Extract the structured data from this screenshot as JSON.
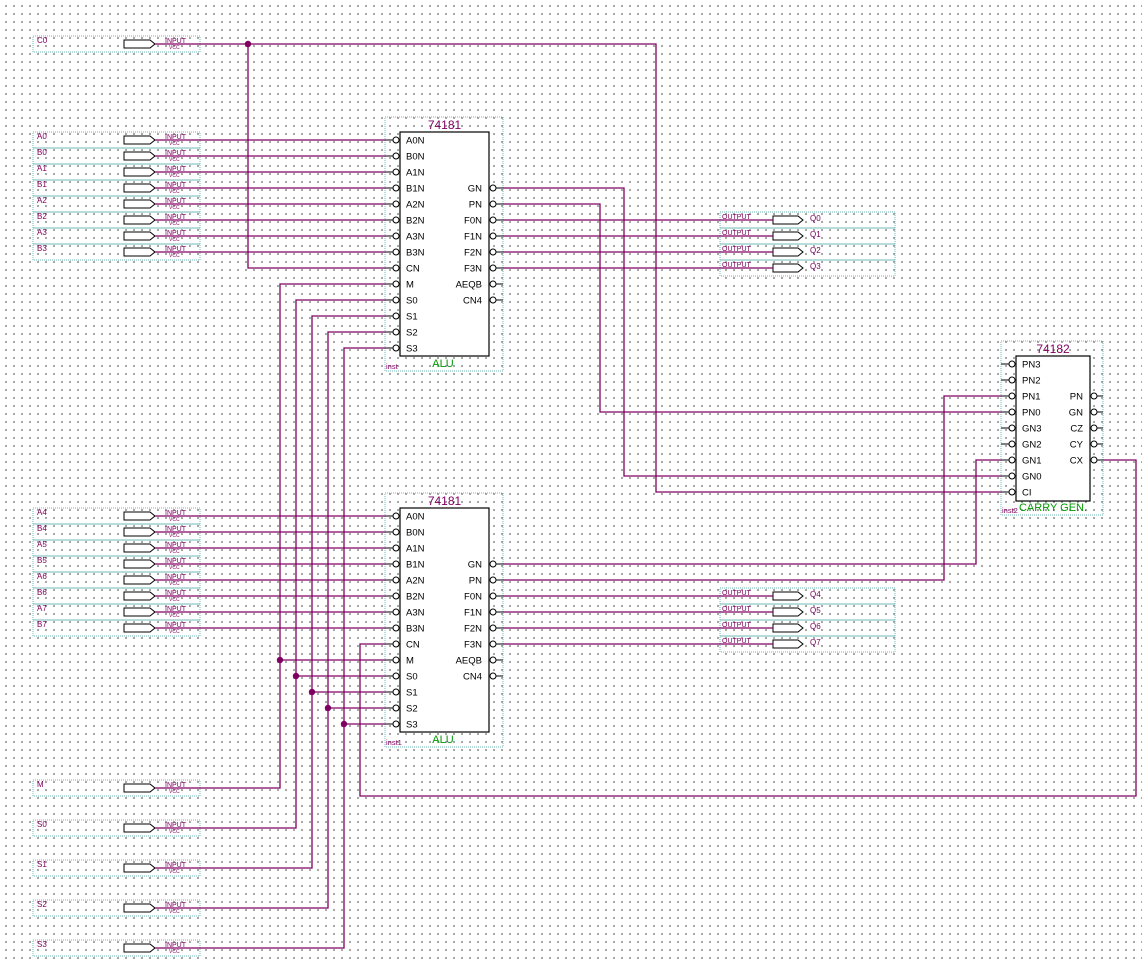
{
  "input_pins": [
    {
      "name": "C0",
      "kind": "INPUT",
      "sub": "VCC"
    },
    {
      "name": "A0",
      "kind": "INPUT",
      "sub": "VCC"
    },
    {
      "name": "B0",
      "kind": "INPUT",
      "sub": "VCC"
    },
    {
      "name": "A1",
      "kind": "INPUT",
      "sub": "VCC"
    },
    {
      "name": "B1",
      "kind": "INPUT",
      "sub": "VCC"
    },
    {
      "name": "A2",
      "kind": "INPUT",
      "sub": "VCC"
    },
    {
      "name": "B2",
      "kind": "INPUT",
      "sub": "VCC"
    },
    {
      "name": "A3",
      "kind": "INPUT",
      "sub": "VCC"
    },
    {
      "name": "B3",
      "kind": "INPUT",
      "sub": "VCC"
    },
    {
      "name": "A4",
      "kind": "INPUT",
      "sub": "VCC"
    },
    {
      "name": "B4",
      "kind": "INPUT",
      "sub": "VCC"
    },
    {
      "name": "A5",
      "kind": "INPUT",
      "sub": "VCC"
    },
    {
      "name": "B5",
      "kind": "INPUT",
      "sub": "VCC"
    },
    {
      "name": "A6",
      "kind": "INPUT",
      "sub": "VCC"
    },
    {
      "name": "B6",
      "kind": "INPUT",
      "sub": "VCC"
    },
    {
      "name": "A7",
      "kind": "INPUT",
      "sub": "VCC"
    },
    {
      "name": "B7",
      "kind": "INPUT",
      "sub": "VCC"
    },
    {
      "name": "M",
      "kind": "INPUT",
      "sub": "VCC"
    },
    {
      "name": "S0",
      "kind": "INPUT",
      "sub": "VCC"
    },
    {
      "name": "S1",
      "kind": "INPUT",
      "sub": "VCC"
    },
    {
      "name": "S2",
      "kind": "INPUT",
      "sub": "VCC"
    },
    {
      "name": "S3",
      "kind": "INPUT",
      "sub": "VCC"
    }
  ],
  "output_pins": [
    {
      "name": "Q0",
      "kind": "OUTPUT"
    },
    {
      "name": "Q1",
      "kind": "OUTPUT"
    },
    {
      "name": "Q2",
      "kind": "OUTPUT"
    },
    {
      "name": "Q3",
      "kind": "OUTPUT"
    },
    {
      "name": "Q4",
      "kind": "OUTPUT"
    },
    {
      "name": "Q5",
      "kind": "OUTPUT"
    },
    {
      "name": "Q6",
      "kind": "OUTPUT"
    },
    {
      "name": "Q7",
      "kind": "OUTPUT"
    }
  ],
  "alu_chips": [
    {
      "part": "74181",
      "label": "ALU",
      "instance": "inst",
      "left_ports": [
        "A0N",
        "B0N",
        "A1N",
        "B1N",
        "A2N",
        "B2N",
        "A3N",
        "B3N",
        "CN",
        "M",
        "S0",
        "S1",
        "S2",
        "S3"
      ],
      "right_ports": [
        "GN",
        "PN",
        "F0N",
        "F1N",
        "F2N",
        "F3N",
        "AEQB",
        "CN4"
      ]
    },
    {
      "part": "74181",
      "label": "ALU",
      "instance": "inst1",
      "left_ports": [
        "A0N",
        "B0N",
        "A1N",
        "B1N",
        "A2N",
        "B2N",
        "A3N",
        "B3N",
        "CN",
        "M",
        "S0",
        "S1",
        "S2",
        "S3"
      ],
      "right_ports": [
        "GN",
        "PN",
        "F0N",
        "F1N",
        "F2N",
        "F3N",
        "AEQB",
        "CN4"
      ]
    }
  ],
  "carry_chip": {
    "part": "74182",
    "label": "CARRY GEN.",
    "instance": "inst2",
    "left_ports": [
      "PN3",
      "PN2",
      "PN1",
      "PN0",
      "GN3",
      "GN2",
      "GN1",
      "GN0",
      "CI"
    ],
    "right_ports": [
      "PN",
      "GN",
      "CZ",
      "CY",
      "CX"
    ]
  },
  "colors": {
    "wire": "#800060",
    "pin_box": "#6fb8b8",
    "chip_label": "#009900",
    "grid_dot": "#8a8a8a"
  }
}
